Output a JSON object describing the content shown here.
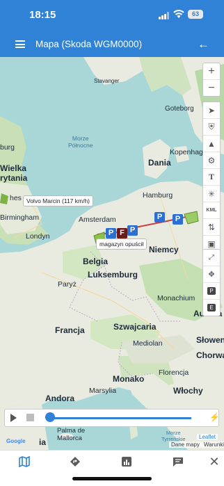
{
  "status_bar": {
    "time": "18:15",
    "battery": "63"
  },
  "app_bar": {
    "title": "Mapa (Skoda WGM0000)"
  },
  "map": {
    "labels": {
      "stavanger": "Stavanger",
      "goteborg": "Goteborg",
      "morze_polnocne": "Morze\nPółnocne",
      "dania": "Dania",
      "kopenhaga": "Kopenhag",
      "burg": "burg",
      "wielka": "Wielka",
      "brytania": "rytania",
      "hamburg": "Hamburg",
      "hes": "hes",
      "birmingham": "Birmingham",
      "amsterdam": "Amsterdam",
      "londyn": "Londyn",
      "niemcy": "Niemcy",
      "belgia": "Belgia",
      "luksemburg": "Luksemburg",
      "paryz": "Paryż",
      "monachium": "Monachium",
      "austria": "Austria",
      "francja": "Francja",
      "szwajcaria": "Szwajcaria",
      "mediolan": "Mediolan",
      "slowenia": "Słowen",
      "chorwacja": "Chorwa",
      "monako": "Monako",
      "florencja": "Florencja",
      "wlochy": "Włochy",
      "andora": "Andora",
      "marsylia": "Marsylia",
      "palma": "Palma de\nMallorca",
      "ia": "ia",
      "morze_tyrrenskie": "Morze\nTyrreńskie"
    },
    "tooltip_vehicle": "Volvo Marcin (117 km/h)",
    "tooltip_warehouse": "magazyn opuścił",
    "parking_label": "P",
    "fuel_label": "F",
    "attribution_leaflet": "Leaflet",
    "attribution_dane": "Dane mapy",
    "attribution_warunki": "Warunki",
    "google": "Google"
  },
  "toolbar": {
    "zoom_in": "+",
    "zoom_out": "−",
    "text_tool": "T",
    "kml": "KML",
    "p_marker": "P",
    "e_marker": "E"
  },
  "colors": {
    "brand": "#2f82d6",
    "water": "#a9d7d8",
    "land": "#e9ebe0",
    "forest": "#b7d9a8",
    "route": "#c94040"
  }
}
